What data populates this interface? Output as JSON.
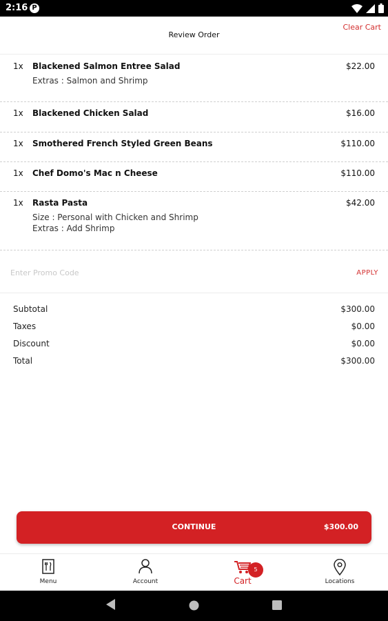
{
  "status_bar": {
    "time": "2:16",
    "notification_icon": "p-icon",
    "notification_letter": "P",
    "icons": [
      "wifi-icon",
      "signal-icon",
      "battery-icon"
    ]
  },
  "header": {
    "title": "Review Order",
    "clear_cart": "Clear Cart"
  },
  "items": [
    {
      "qty": "1x",
      "name": "Blackened Salmon Entree Salad",
      "price": "$22.00",
      "details": [
        "Extras : Salmon and Shrimp"
      ]
    },
    {
      "qty": "1x",
      "name": "Blackened Chicken Salad",
      "price": "$16.00",
      "details": []
    },
    {
      "qty": "1x",
      "name": "Smothered French Styled Green Beans",
      "price": "$110.00",
      "details": []
    },
    {
      "qty": "1x",
      "name": "Chef Domo's Mac n Cheese",
      "price": "$110.00",
      "details": []
    },
    {
      "qty": "1x",
      "name": "Rasta Pasta",
      "price": "$42.00",
      "details": [
        "Size : Personal with Chicken and Shrimp",
        "Extras : Add Shrimp"
      ]
    }
  ],
  "promo": {
    "placeholder": "Enter Promo Code",
    "apply": "APPLY"
  },
  "totals": [
    {
      "label": "Subtotal",
      "value": "$300.00"
    },
    {
      "label": "Taxes",
      "value": "$0.00"
    },
    {
      "label": "Discount",
      "value": "$0.00"
    },
    {
      "label": "Total",
      "value": "$300.00"
    }
  ],
  "continue": {
    "label": "CONTINUE",
    "amount": "$300.00"
  },
  "bottom_nav": [
    {
      "label": "Menu",
      "icon": "menu-fork-knife-icon",
      "active": false
    },
    {
      "label": "Account",
      "icon": "person-icon",
      "active": false
    },
    {
      "label": "Cart",
      "icon": "cart-icon",
      "active": true,
      "badge": "5"
    },
    {
      "label": "Locations",
      "icon": "location-pin-icon",
      "active": false
    }
  ],
  "colors": {
    "accent": "#d32124",
    "link": "#d32f2f"
  }
}
